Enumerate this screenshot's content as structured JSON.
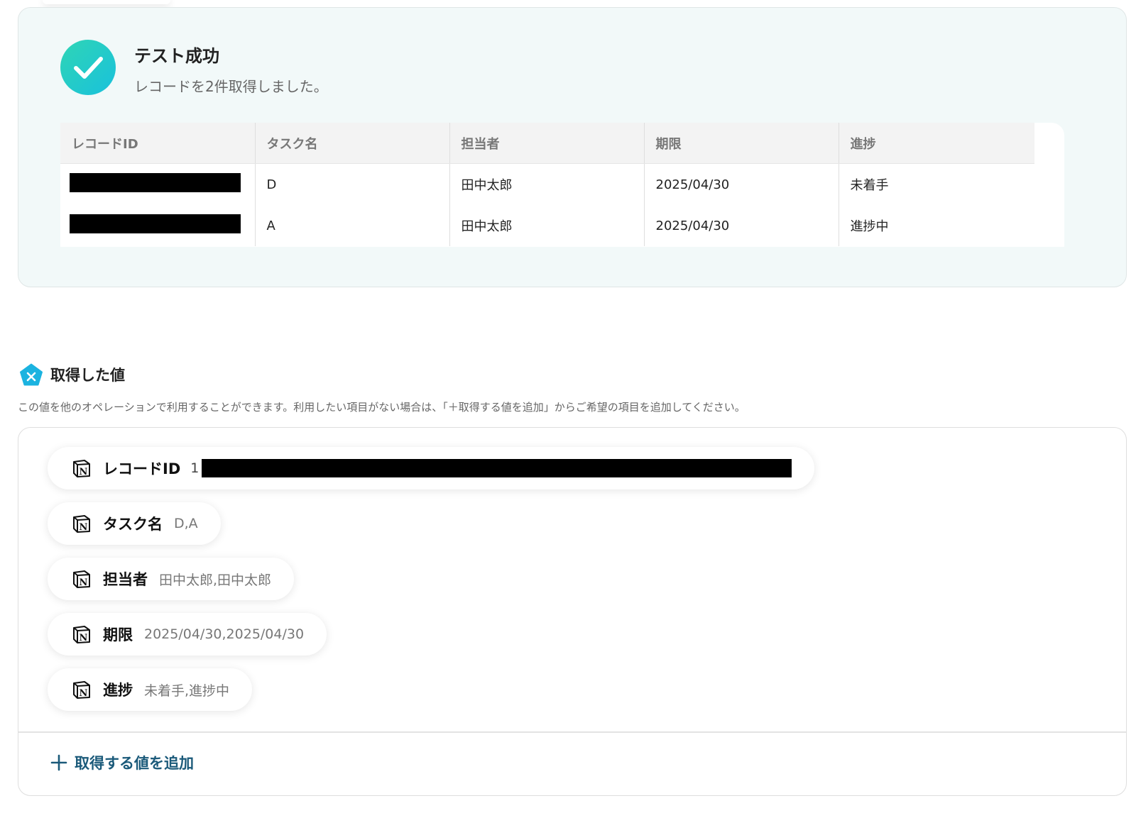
{
  "test_result": {
    "title": "テスト成功",
    "message": "レコードを2件取得しました。",
    "table": {
      "headers": [
        "レコードID",
        "タスク名",
        "担当者",
        "期限",
        "進捗"
      ],
      "rows": [
        {
          "task": "D",
          "assignee": "田中太郎",
          "due": "2025/04/30",
          "status": "未着手"
        },
        {
          "task": "A",
          "assignee": "田中太郎",
          "due": "2025/04/30",
          "status": "進捗中"
        }
      ]
    }
  },
  "retrieved": {
    "title": "取得した値",
    "description": "この値を他のオペレーションで利用することができます。利用したい項目がない場合は、「＋取得する値を追加」からご希望の項目を追加してください。",
    "fields": [
      {
        "label": "レコードID",
        "value": "1"
      },
      {
        "label": "タスク名",
        "value": "D,A"
      },
      {
        "label": "担当者",
        "value": "田中太郎,田中太郎"
      },
      {
        "label": "期限",
        "value": "2025/04/30,2025/04/30"
      },
      {
        "label": "進捗",
        "value": "未着手,進捗中"
      }
    ],
    "add_label": "取得する値を追加"
  },
  "icons": {
    "success": "check-icon",
    "section": "variable-x-icon",
    "field": "notion-icon",
    "add": "plus-icon"
  },
  "colors": {
    "success_gradient_start": "#2fd5b5",
    "success_gradient_end": "#19c1dc",
    "section_icon": "#1bb3e0",
    "add_button": "#1b5a7a",
    "card_background": "#f2f9f9"
  }
}
